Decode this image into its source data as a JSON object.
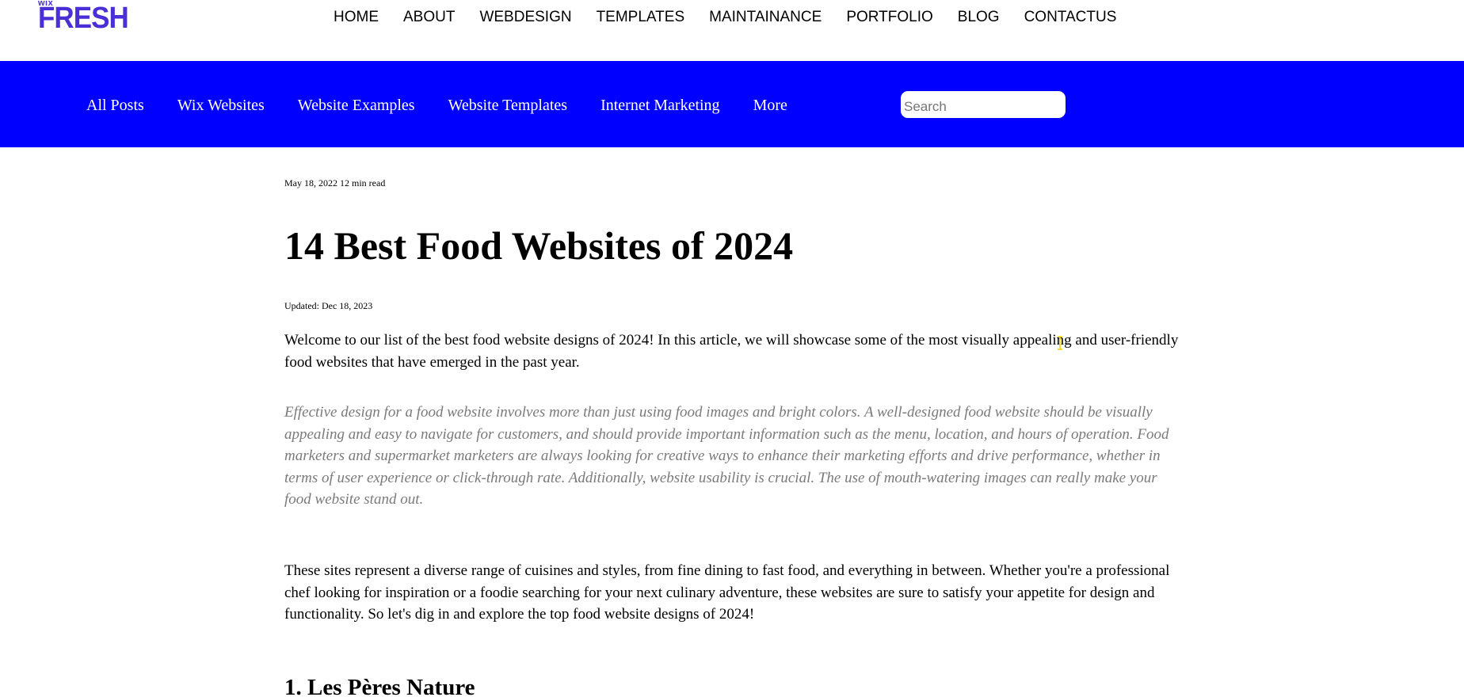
{
  "header": {
    "logo_small": "wix",
    "logo_main": "FRESH",
    "logo_color": "#4b2fd6",
    "nav": [
      "HOME",
      "ABOUT",
      "WEBDESIGN",
      "TEMPLATES",
      "MAINTAINANCE",
      "PORTFOLIO",
      "BLOG",
      "CONTACTUS"
    ]
  },
  "category_bar": {
    "background": "#0000ff",
    "items": [
      "All Posts",
      "Wix Websites",
      "Website Examples",
      "Website Templates",
      "Internet Marketing",
      "More"
    ],
    "search": {
      "placeholder": "Search",
      "value": ""
    }
  },
  "article": {
    "meta": "May 18, 2022 12 min read",
    "title": "14 Best Food Websites of 2024",
    "updated": "Updated: Dec 18, 2023",
    "intro": "Welcome to our list of the best food website designs of 2024! In this article, we will showcase some of the most visually appealing and user-friendly food websites that have emerged in the past year.",
    "quote": "Effective design for a food website involves more than just using food images and bright colors. A well-designed food website should be visually appealing and easy to navigate for customers, and should provide important information such as the menu, location, and hours of operation. Food marketers and supermarket marketers are always looking for creative ways to enhance their marketing efforts and drive performance, whether in terms of user experience or click-through rate. Additionally, website usability is crucial. The use of mouth-watering images can really make your food website stand out.",
    "body": "These sites represent a diverse range of cuisines and styles, from fine dining to fast food, and everything in between. Whether you're a professional chef looking for inspiration or a foodie searching for your next culinary adventure, these websites are sure to satisfy your appetite for design and functionality. So let's dig in and explore the top food website designs of 2024!",
    "section_heading": "1. Les Pères Nature"
  }
}
